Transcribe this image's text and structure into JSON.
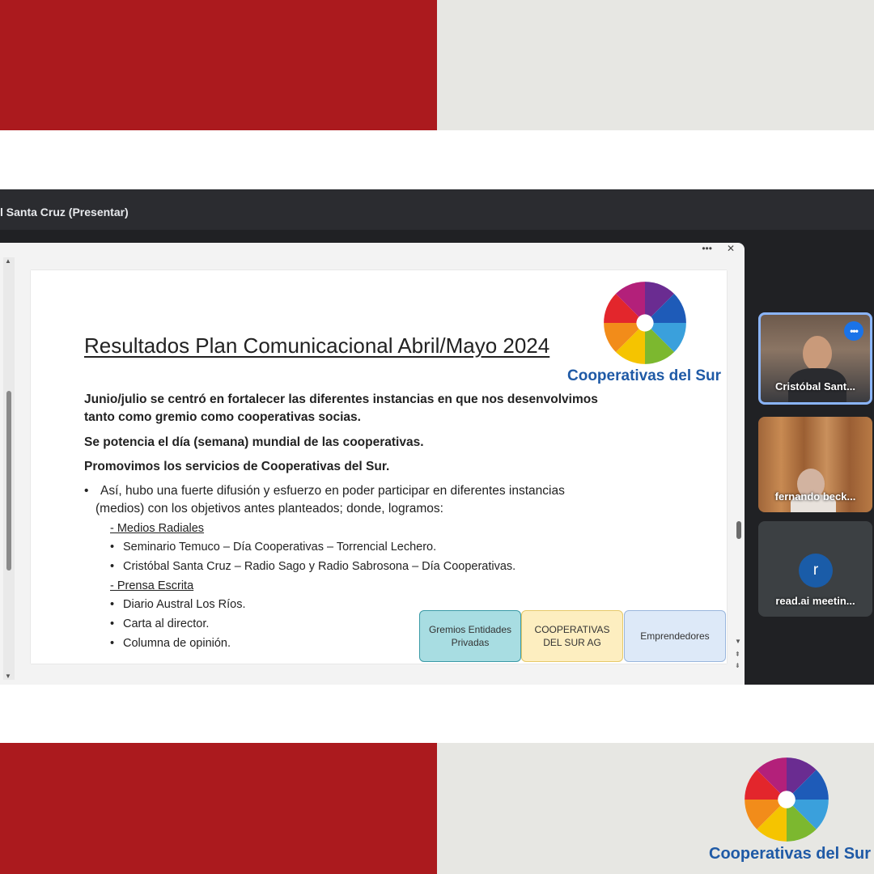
{
  "frame": {
    "colors": {
      "red": "#ab1a1e",
      "grey": "#e7e7e3",
      "brand_blue": "#1f5aa6"
    }
  },
  "meeting": {
    "presenter_title": "l Santa Cruz (Presentar)",
    "window_controls": {
      "more_icon": "more-horizontal-icon",
      "more_glyph": "•••",
      "close_icon": "close-icon",
      "close_glyph": "✕"
    },
    "participants": [
      {
        "name": "Cristóbal Sant...",
        "more_glyph": "•••",
        "speaking": true
      },
      {
        "name": "fernando beck..."
      },
      {
        "name": "read.ai meetin...",
        "avatar_initial": "r"
      }
    ]
  },
  "slide": {
    "title": "Resultados Plan Comunicacional Abril/Mayo 2024",
    "brand": "Cooperativas del Sur",
    "paragraph1_line1": "Junio/julio se centró en fortalecer las diferentes instancias en que nos desenvolvimos",
    "paragraph1_line2": "tanto como gremio como cooperativas socias.",
    "paragraph2": "Se potencia el día (semana) mundial de las cooperativas.",
    "paragraph3": "Promovimos los servicios de Cooperativas del Sur.",
    "bullet_line1": "Así, hubo una fuerte difusión y esfuerzo en poder participar en diferentes instancias",
    "bullet_line2": "(medios) con los objetivos antes planteados; donde, logramos:",
    "section1_heading": "- Medios Radiales",
    "section1_items": [
      "Seminario Temuco – Día Cooperativas – Torrencial Lechero.",
      "Cristóbal Santa Cruz – Radio Sago y Radio Sabrosona – Día Cooperativas."
    ],
    "section2_heading": "- Prensa Escrita",
    "section2_items": [
      "Diario Austral Los Ríos.",
      "Carta al director.",
      "Columna de opinión."
    ],
    "boxes": [
      {
        "line1": "Gremios Entidades",
        "line2": "Privadas"
      },
      {
        "line1": "COOPERATIVAS",
        "line2": "DEL SUR AG"
      },
      {
        "line1": "Emprendedores",
        "line2": ""
      }
    ]
  },
  "footer": {
    "brand": "Cooperativas del Sur"
  }
}
